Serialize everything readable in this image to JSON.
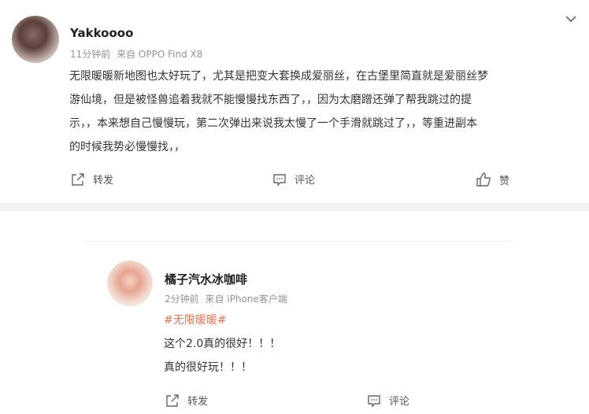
{
  "post": {
    "username": "Yakkoooo",
    "time": "11分钟前",
    "source": "来自 OPPO Find X8",
    "content_lines": [
      "无限暖暖新地图也太好玩了，尤其是把变大套换成爱丽丝，在古堡里简直就是爱丽丝梦",
      "游仙境，但是被怪兽追着我就不能慢慢找东西了，，因为太磨蹭还弹了帮我跳过的提",
      "示，，本来想自己慢慢玩，第二次弹出来说我太慢了一个手滑就跳过了，，等重进副本",
      "的时候我势必慢慢找，，"
    ],
    "actions": {
      "repost": "转发",
      "comment": "评论",
      "like": "赞"
    }
  },
  "reply": {
    "username": "橘子汽水冰咖啡",
    "time": "2分钟前",
    "source": "来自 iPhone客户端",
    "topic": "#无限暖暖#",
    "content_lines": [
      "这个2.0真的很好！！！",
      "真的很好玩！！！"
    ],
    "actions": {
      "repost": "转发",
      "comment": "评论"
    }
  }
}
